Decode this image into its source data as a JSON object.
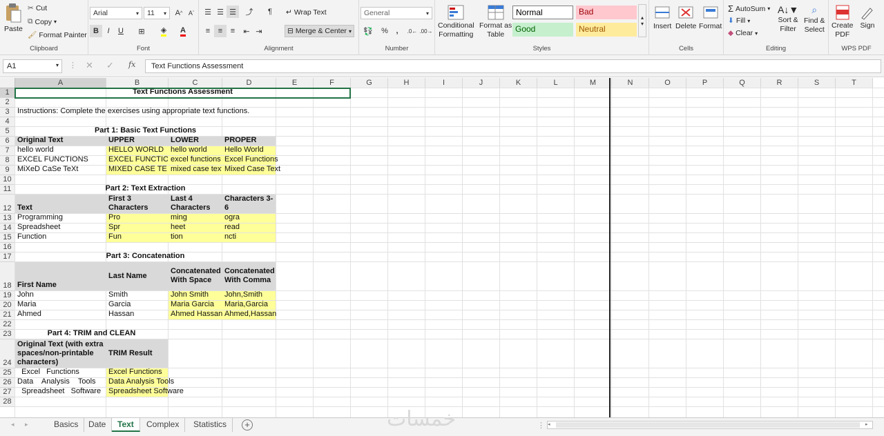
{
  "ribbon": {
    "clipboard": {
      "paste": "Paste",
      "cut": "Cut",
      "copy": "Copy",
      "format_painter": "Format Painter",
      "label": "Clipboard"
    },
    "font": {
      "name": "Arial",
      "size": "11",
      "bold": "B",
      "italic": "I",
      "underline": "U",
      "label": "Font"
    },
    "alignment": {
      "wrap_text": "Wrap Text",
      "merge_center": "Merge & Center",
      "label": "Alignment"
    },
    "number": {
      "format": "General",
      "percent": "%",
      "comma": ",",
      "label": "Number"
    },
    "styles": {
      "conditional": "Conditional",
      "conditional2": "Formatting",
      "format_as": "Format as",
      "format_as2": "Table",
      "normal": "Normal",
      "bad": "Bad",
      "good": "Good",
      "neutral": "Neutral",
      "label": "Styles"
    },
    "cells": {
      "insert": "Insert",
      "delete": "Delete",
      "format": "Format",
      "label": "Cells"
    },
    "editing": {
      "autosum": "AutoSum",
      "fill": "Fill",
      "clear": "Clear",
      "sort_filter": "Sort &",
      "sort_filter2": "Filter",
      "find_select": "Find &",
      "find_select2": "Select",
      "label": "Editing"
    },
    "wps": {
      "create": "Create",
      "create2": "PDF",
      "sign": "Sign",
      "label": "WPS PDF"
    }
  },
  "formula_bar": {
    "name_box": "A1",
    "fx": "fx",
    "content": "Text Functions Assessment"
  },
  "columns": [
    "A",
    "B",
    "C",
    "D",
    "E",
    "F",
    "G",
    "H",
    "I",
    "J",
    "K",
    "L",
    "M",
    "N",
    "O",
    "P",
    "Q",
    "R",
    "S",
    "T"
  ],
  "rows": [
    "1",
    "2",
    "3",
    "4",
    "5",
    "6",
    "7",
    "8",
    "9",
    "10",
    "11",
    "12",
    "13",
    "14",
    "15",
    "16",
    "17",
    "18",
    "19",
    "20",
    "21",
    "22",
    "23",
    "24",
    "25",
    "26",
    "27",
    "28"
  ],
  "sheet": {
    "title": "Text Functions Assessment",
    "instructions": "Instructions: Complete the exercises using appropriate text functions.",
    "part1": {
      "heading": "Part 1: Basic Text Functions",
      "headers": [
        "Original Text",
        "UPPER",
        "LOWER",
        "PROPER"
      ],
      "rows": [
        [
          "hello world",
          "HELLO WORLD",
          "hello world",
          "Hello World"
        ],
        [
          "EXCEL FUNCTIONS",
          "EXCEL FUNCTIO",
          "excel functions",
          "Excel Functions"
        ],
        [
          "MiXeD CaSe TeXt",
          "MIXED CASE TE",
          "mixed case text",
          "Mixed Case Text"
        ]
      ]
    },
    "part2": {
      "heading": "Part 2: Text Extraction",
      "headers": [
        "Text",
        "First 3 Characters",
        "Last 4 Characters",
        "Characters 3-6"
      ],
      "rows": [
        [
          "Programming",
          "Pro",
          "ming",
          "ogra"
        ],
        [
          "Spreadsheet",
          "Spr",
          "heet",
          "read"
        ],
        [
          "Function",
          "Fun",
          "tion",
          "ncti"
        ]
      ]
    },
    "part3": {
      "heading": "Part 3: Concatenation",
      "headers": [
        "First Name",
        "Last Name",
        "Concatenated With Space",
        "Concatenated With Comma"
      ],
      "rows": [
        [
          "John",
          "Smith",
          "John Smith",
          "John,Smith"
        ],
        [
          "Maria",
          "Garcia",
          "Maria Garcia",
          "Maria,Garcia"
        ],
        [
          "Ahmed",
          "Hassan",
          "Ahmed Hassan",
          "Ahmed,Hassan"
        ]
      ]
    },
    "part4": {
      "heading": "Part 4: TRIM and CLEAN",
      "headers": [
        "Original Text (with extra spaces/non-printable characters)",
        "TRIM Result"
      ],
      "rows": [
        [
          "  Excel   Functions",
          "Excel Functions"
        ],
        [
          "Data    Analysis    Tools",
          "Data Analysis Tools"
        ],
        [
          "  Spreadsheet   Software",
          "Spreadsheet Software"
        ]
      ]
    }
  },
  "tabs": [
    "Basics",
    "Date",
    "Text",
    "Complex",
    "Statistics"
  ],
  "active_tab": "Text",
  "watermark": "خمسات",
  "colors": {
    "accent": "#217346",
    "yellow": "#ffff99",
    "gray": "#d9d9d9",
    "bad_bg": "#ffc7ce",
    "good_bg": "#c6efce",
    "neutral_bg": "#ffeb9c"
  }
}
